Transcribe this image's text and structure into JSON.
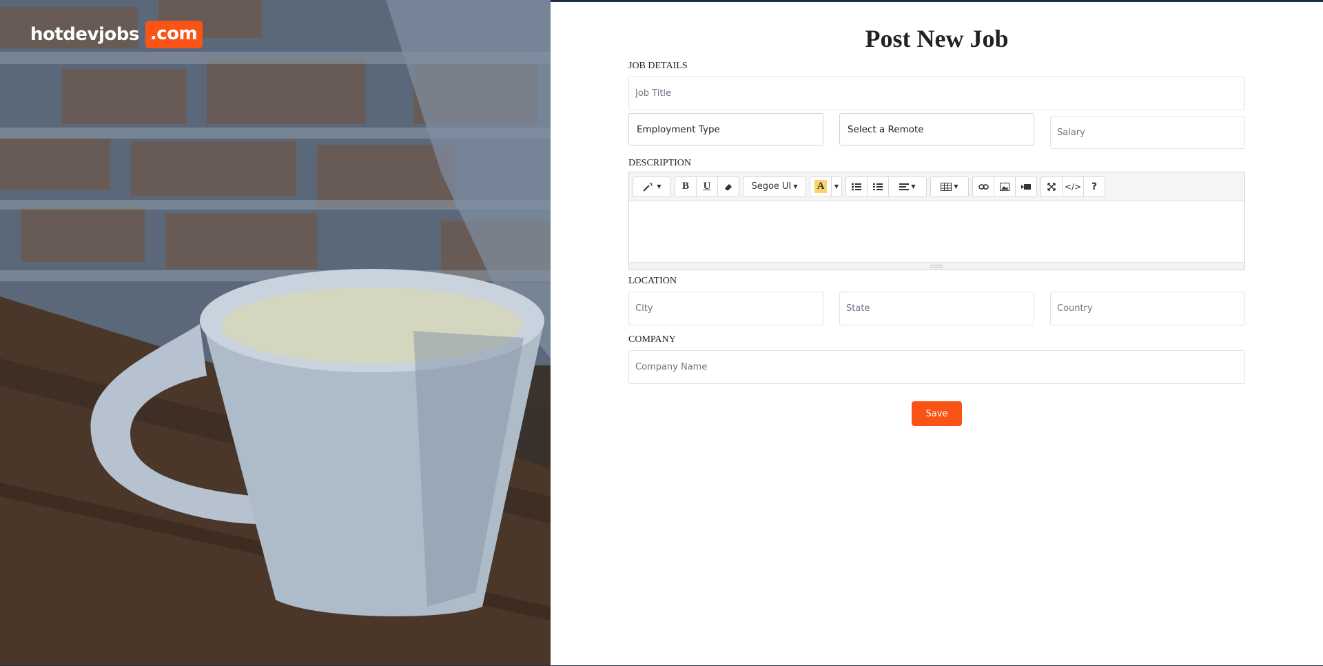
{
  "brand": {
    "name": "hotdevjobs",
    "tld": ".com",
    "accent": "#fa5316"
  },
  "page": {
    "title": "Post New Job"
  },
  "sections": {
    "job_details": "JOB DETAILS",
    "description": "DESCRIPTION",
    "location": "LOCATION",
    "company": "COMPANY"
  },
  "fields": {
    "job_title": {
      "placeholder": "Job Title",
      "value": ""
    },
    "employment_type": {
      "value": "Employment Type"
    },
    "remote": {
      "value": "Select a Remote"
    },
    "salary": {
      "placeholder": "Salary",
      "value": ""
    },
    "city": {
      "placeholder": "City",
      "value": ""
    },
    "state": {
      "placeholder": "State",
      "value": ""
    },
    "country": {
      "placeholder": "Country",
      "value": ""
    },
    "company_name": {
      "placeholder": "Company Name",
      "value": ""
    }
  },
  "editor": {
    "font_name": "Segoe UI",
    "tools": [
      "magic-wand-icon",
      "bold-icon",
      "underline-icon",
      "eraser-icon",
      "font-family",
      "text-color-icon",
      "unordered-list-icon",
      "ordered-list-icon",
      "paragraph-align-icon",
      "table-icon",
      "link-icon",
      "picture-icon",
      "video-icon",
      "fullscreen-icon",
      "code-view-icon",
      "help-icon"
    ],
    "content": ""
  },
  "actions": {
    "save_label": "Save"
  }
}
